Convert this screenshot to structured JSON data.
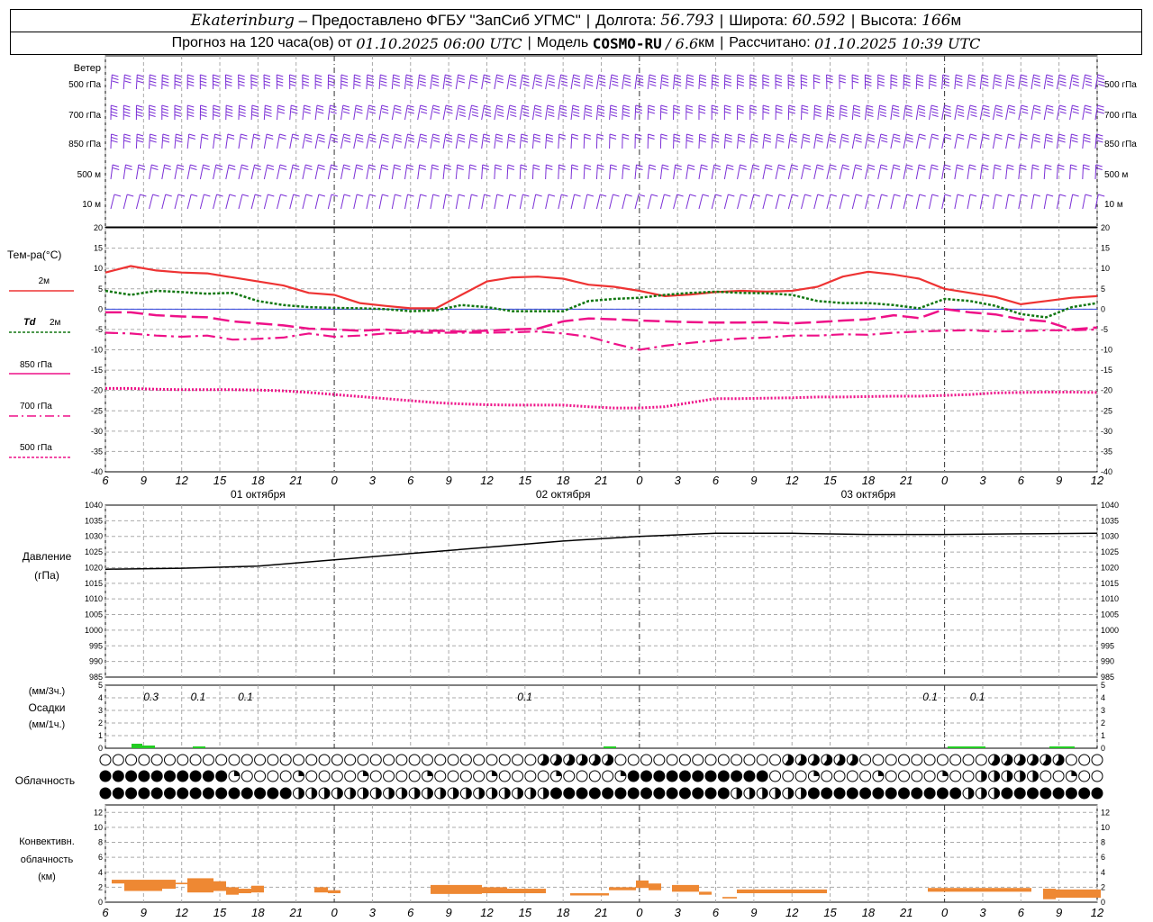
{
  "header": {
    "city": "Ekaterinburg",
    "provider": "– Предоставлено ФГБУ \"ЗапСиб УГМС\"",
    "lon_label": "Долгота:",
    "lon_value": "56.793",
    "lat_label": "Широта:",
    "lat_value": "60.592",
    "alt_label": "Высота:",
    "alt_value": "166",
    "alt_unit": "м",
    "forecast_prefix": "Прогноз на 120 часа(ов) от",
    "forecast_start": "01.10.2025 06:00 UTC",
    "model_label": "Модель",
    "model_name": "COSMO-RU",
    "model_res": "/ 6.6",
    "model_res_unit": "км",
    "computed_label": "Рассчитано:",
    "computed_value": "01.10.2025 10:39 UTC"
  },
  "colors": {
    "wind": "#7b2fd6",
    "t2m": "#ee3333",
    "td2m": "#117711",
    "t850": "#ee1188",
    "t700": "#ee1188",
    "t500": "#ee1188",
    "zero_line": "#3344dd",
    "pressure": "#000000",
    "precip": "#22cc22",
    "convective": "#ee8833",
    "grid": "#aaaaaa"
  },
  "time_axis": {
    "hours": [
      6,
      9,
      12,
      15,
      18,
      21,
      0,
      3,
      6,
      9,
      12,
      15,
      18,
      21,
      0,
      3,
      6,
      9,
      12,
      15,
      18,
      21,
      0,
      3,
      6,
      9,
      12
    ],
    "tick_labels": [
      "6",
      "9",
      "12",
      "15",
      "18",
      "21",
      "0",
      "3",
      "6",
      "9",
      "12",
      "15",
      "18",
      "21",
      "0",
      "3",
      "6",
      "9",
      "12",
      "15",
      "18",
      "21",
      "0",
      "3",
      "6",
      "9",
      "12"
    ],
    "day_labels": [
      "01 октября",
      "02 октября",
      "03 октября"
    ],
    "day_label_hours": [
      12,
      36,
      60
    ],
    "midnight_hours": [
      18,
      42,
      66,
      90
    ]
  },
  "wind_panel": {
    "title": "Ветер",
    "levels": [
      "500 гПа",
      "700 гПа",
      "850 гПа",
      "500 м",
      "10  м"
    ],
    "level_speed_ms": [
      22,
      18,
      14,
      11,
      4
    ],
    "level_direction_deg": [
      250,
      245,
      240,
      235,
      200
    ]
  },
  "temp_panel": {
    "title": "Тем-ра(°C)",
    "ylim": [
      -40,
      20
    ],
    "yticks": [
      "20",
      "15",
      "10",
      "5",
      "0",
      "-5",
      "-10",
      "-15",
      "-20",
      "-25",
      "-30",
      "-35",
      "-40"
    ],
    "legend": {
      "t2m": "2м",
      "td_sym": "Td",
      "td_level": "2м",
      "t850": "850 гПа",
      "t700": "700 гПа",
      "t500": "500 гПа"
    }
  },
  "pressure_panel": {
    "title1": "Давление",
    "title2": "(гПа)",
    "ylim": [
      985,
      1040
    ],
    "yticks": [
      "1040",
      "1035",
      "1030",
      "1025",
      "1020",
      "1015",
      "1010",
      "1005",
      "1000",
      "995",
      "990",
      "985"
    ]
  },
  "precip_panel": {
    "title1": "(мм/3ч.)",
    "title2": "Осадки",
    "title3": "(мм/1ч.)",
    "ylim": [
      0,
      5
    ],
    "yticks": [
      "5",
      "4",
      "3",
      "2",
      "1",
      "0"
    ],
    "labels": [
      {
        "hour": 3.5,
        "text": "0.3"
      },
      {
        "hour": 9.5,
        "text": "0.1"
      },
      {
        "hour": 15.5,
        "text": "0.1"
      },
      {
        "hour": 51,
        "text": "0.1"
      },
      {
        "hour": 102.5,
        "text": "0.1"
      },
      {
        "hour": 108.5,
        "text": "0.1"
      }
    ]
  },
  "cloud_panel": {
    "title": "Облачность"
  },
  "conv_panel": {
    "title1": "Конвективн.",
    "title2": "облачность",
    "title3": "(км)",
    "ylim": [
      0,
      13
    ],
    "yticks": [
      "12",
      "10",
      "8",
      "6",
      "4",
      "2",
      "0"
    ]
  },
  "chart_data": {
    "type": "line",
    "x_hours_from_start": [
      0,
      3,
      6,
      9,
      12,
      15,
      18,
      21,
      24,
      27,
      30,
      33,
      36,
      39,
      42,
      45,
      48,
      51,
      54,
      57,
      60,
      63,
      66,
      69,
      72,
      75,
      78
    ],
    "t2m_hours": [
      0,
      2,
      4,
      6,
      8,
      10,
      12,
      14,
      16,
      18,
      20,
      22,
      24,
      26,
      28,
      30,
      32,
      34,
      36,
      38,
      40,
      42,
      44,
      46,
      48,
      50,
      52,
      54,
      56,
      58,
      60,
      62,
      64,
      66,
      68,
      70,
      72,
      74,
      76,
      78
    ],
    "series": [
      {
        "name": "2м",
        "key": "t2m",
        "values": [
          9,
          10.6,
          9.5,
          9,
          8.8,
          7.8,
          6.8,
          5.8,
          4,
          3.5,
          1.5,
          0.8,
          0.2,
          0.2,
          3.5,
          6.8,
          7.8,
          8,
          7.5,
          6,
          5.5,
          4.5,
          3.2,
          3.6,
          4.2,
          4.5,
          4.3,
          4.5,
          5.5,
          8,
          9.2,
          8.5,
          7.5,
          5,
          4,
          3,
          1.2,
          2,
          2.8,
          3.2
        ]
      },
      {
        "name": "Td 2м",
        "key": "td2m",
        "values": [
          4.5,
          3.5,
          4.5,
          4.2,
          3.8,
          4,
          2,
          1,
          0.5,
          0.3,
          0.2,
          0,
          -0.5,
          -0.3,
          1,
          0.5,
          -0.5,
          -0.5,
          -0.5,
          2,
          2.5,
          2.8,
          3.5,
          4,
          4.3,
          4,
          3.9,
          3.5,
          2,
          1.5,
          1.5,
          1,
          0.2,
          2.5,
          2,
          0.8,
          -1.2,
          -2,
          0.5,
          1.5
        ]
      },
      {
        "name": "850 гПа",
        "key": "t850",
        "values": [
          -0.8,
          -0.8,
          -1.5,
          -1.8,
          -2,
          -3,
          -3.5,
          -4,
          -4.8,
          -5,
          -5.3,
          -5,
          -5.5,
          -5.3,
          -5.5,
          -5.3,
          -5,
          -4.8,
          -3,
          -2.3,
          -2.5,
          -2.8,
          -3,
          -3.2,
          -3.3,
          -3.3,
          -3.2,
          -3.5,
          -3.2,
          -2.8,
          -2.5,
          -1.5,
          -2.2,
          0,
          -0.8,
          -1.3,
          -2.5,
          -3,
          -5,
          -4.5
        ]
      },
      {
        "name": "700 гПа",
        "key": "t700",
        "values": [
          -5.8,
          -6,
          -6.5,
          -6.8,
          -6.5,
          -7.5,
          -7.3,
          -7,
          -6,
          -6.8,
          -6.5,
          -6,
          -5.8,
          -5.8,
          -5.8,
          -5.8,
          -5.7,
          -5.5,
          -6,
          -6.8,
          -8.5,
          -10,
          -9,
          -8.3,
          -7.7,
          -7.2,
          -7,
          -6.5,
          -6.5,
          -6.2,
          -6.3,
          -5.8,
          -5.5,
          -5.3,
          -5.2,
          -5.5,
          -5.4,
          -5.2,
          -5.2,
          -5
        ]
      },
      {
        "name": "500 гПа",
        "key": "t500",
        "values": [
          -19.5,
          -19.5,
          -19.7,
          -19.8,
          -19.8,
          -19.8,
          -19.9,
          -20.1,
          -20.5,
          -21,
          -21.5,
          -22,
          -22.5,
          -23,
          -23.3,
          -23.5,
          -23.6,
          -23.6,
          -23.6,
          -24,
          -24.3,
          -24.3,
          -24,
          -23,
          -22,
          -22,
          -21.9,
          -21.8,
          -21.6,
          -21.6,
          -21.5,
          -21.4,
          -21.4,
          -21.2,
          -21,
          -20.6,
          -20.5,
          -20.4,
          -20.4,
          -20.5
        ]
      }
    ],
    "pressure_hours": [
      0,
      6,
      12,
      18,
      24,
      30,
      36,
      42,
      48,
      54,
      60,
      66,
      72,
      78
    ],
    "pressure_values": [
      1019.5,
      1019.8,
      1020.5,
      1022.5,
      1024.5,
      1026.5,
      1028.5,
      1030,
      1031,
      1031,
      1030.6,
      1030.6,
      1030.8,
      1031
    ]
  }
}
